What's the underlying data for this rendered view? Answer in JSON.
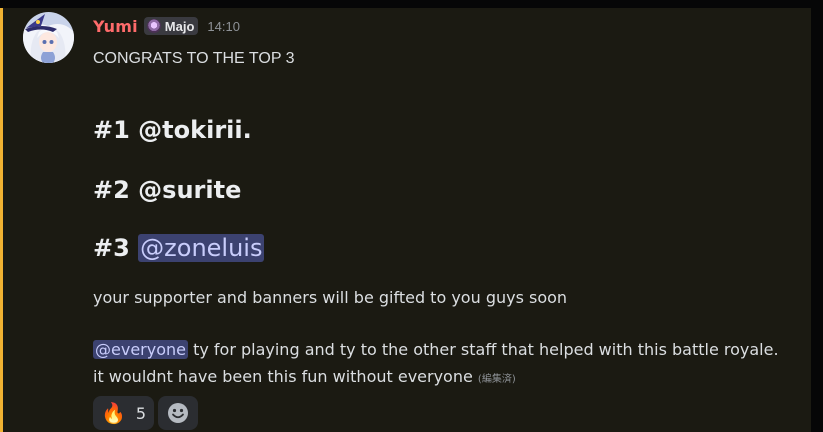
{
  "message": {
    "username": "Yumi",
    "tag_label": "Majo",
    "timestamp": "14:10",
    "line1": "CONGRATS TO THE TOP 3",
    "rank1_prefix": "#1 ",
    "rank1_name": "@tokirii.",
    "rank2_prefix": "#2 ",
    "rank2_name": "@surite",
    "rank3_prefix": "#3 ",
    "rank3_mention": "@zoneluis",
    "supporter_text": "your supporter and banners will be gifted to you guys soon",
    "everyone_mention": "@everyone",
    "thanks_text": " ty for playing and ty to the other staff that helped with this battle royale.",
    "closing_text": "it wouldnt have been this fun without everyone ",
    "edited_label": "(編集済)"
  },
  "reactions": [
    {
      "emoji": "🔥",
      "count": "5"
    }
  ],
  "colors": {
    "username": "#ff6b6b",
    "mention_bg": "#3c4270",
    "mention_text": "#c9cdfb",
    "highlight_bar": "#f0b232",
    "message_bg": "#1b1a12"
  },
  "icons": {
    "add_reaction": "smiley-face-icon",
    "tag": "majo-role-icon"
  }
}
